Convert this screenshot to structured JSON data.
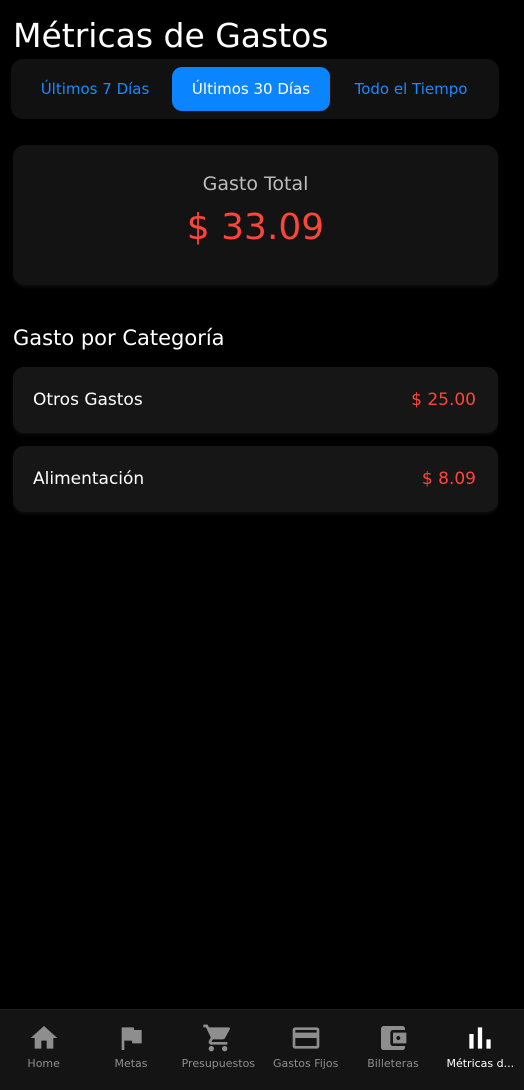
{
  "header": {
    "title": "Métricas de Gastos"
  },
  "period_selector": {
    "options": [
      {
        "label": "Últimos 7 Días",
        "selected": false
      },
      {
        "label": "Últimos 30 Días",
        "selected": true
      },
      {
        "label": "Todo el Tiempo",
        "selected": false
      }
    ]
  },
  "total_card": {
    "label": "Gasto Total",
    "amount": "$ 33.09"
  },
  "categories": {
    "title": "Gasto por Categoría",
    "items": [
      {
        "name": "Otros Gastos",
        "amount": "$ 25.00"
      },
      {
        "name": "Alimentación",
        "amount": "$ 8.09"
      }
    ]
  },
  "bottom_nav": {
    "items": [
      {
        "label": "Home",
        "icon": "home-icon",
        "active": false
      },
      {
        "label": "Metas",
        "icon": "flag-icon",
        "active": false
      },
      {
        "label": "Presupuestos",
        "icon": "shopping-cart-icon",
        "active": false
      },
      {
        "label": "Gastos Fijos",
        "icon": "credit-card-icon",
        "active": false
      },
      {
        "label": "Billeteras",
        "icon": "wallet-icon",
        "active": false
      },
      {
        "label": "Métricas d...",
        "icon": "bar-chart-icon",
        "active": true
      }
    ]
  },
  "colors": {
    "accent": "#0a84ff",
    "accent_text": "#1e88ff",
    "expense": "#ff453a",
    "background": "#000000",
    "card": "#131313",
    "nav_inactive": "#8e8e8e",
    "nav_active": "#ffffff"
  }
}
